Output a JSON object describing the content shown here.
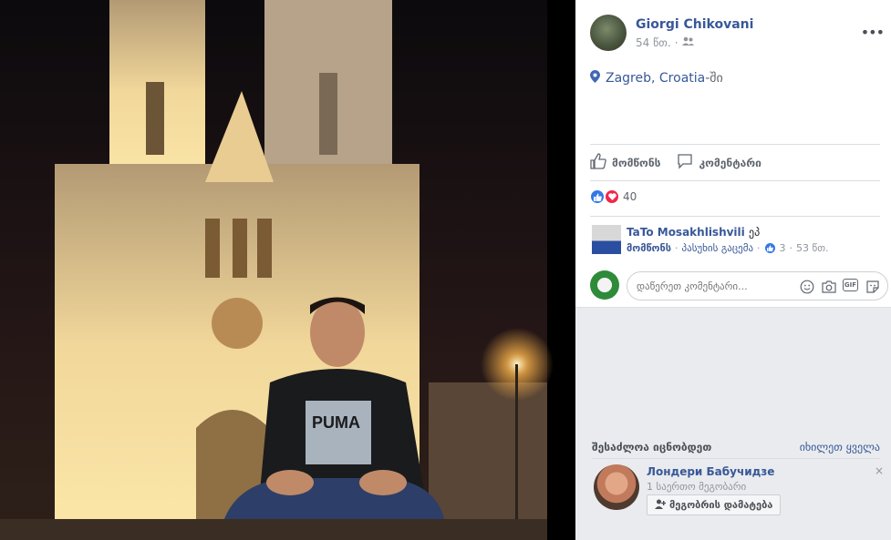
{
  "post": {
    "author": "Giorgi Chikovani",
    "time": "54 წთ.",
    "dot": "·",
    "more": "•••",
    "location_name": "Zagreb, Croatia",
    "location_suffix": "-ში"
  },
  "actions": {
    "like": "მომწონს",
    "comment": "კომენტარი"
  },
  "reactions": {
    "count": "40"
  },
  "comment": {
    "author": "TaTo Mosakhlishvili",
    "reply_suffix": "ეპ",
    "like": "მომწონს",
    "reply": "პასუხის გაცემა",
    "likes": "3",
    "time": "53 წთ.",
    "dot": "·"
  },
  "compose": {
    "placeholder": "დაწერეთ კომენტარი...",
    "gif": "GIF"
  },
  "pymk": {
    "title": "შესაძლოა იცნობდეთ",
    "see_all": "იხილეთ ყველა",
    "person_name": "Лондери Бабучидзе",
    "mutual": "1 საერთო მეგობარი",
    "add_button": "მეგობრის დამატება",
    "close": "×"
  },
  "colors": {
    "link": "#385898",
    "like_blue": "#3578e5",
    "love_red": "#f0284a"
  }
}
